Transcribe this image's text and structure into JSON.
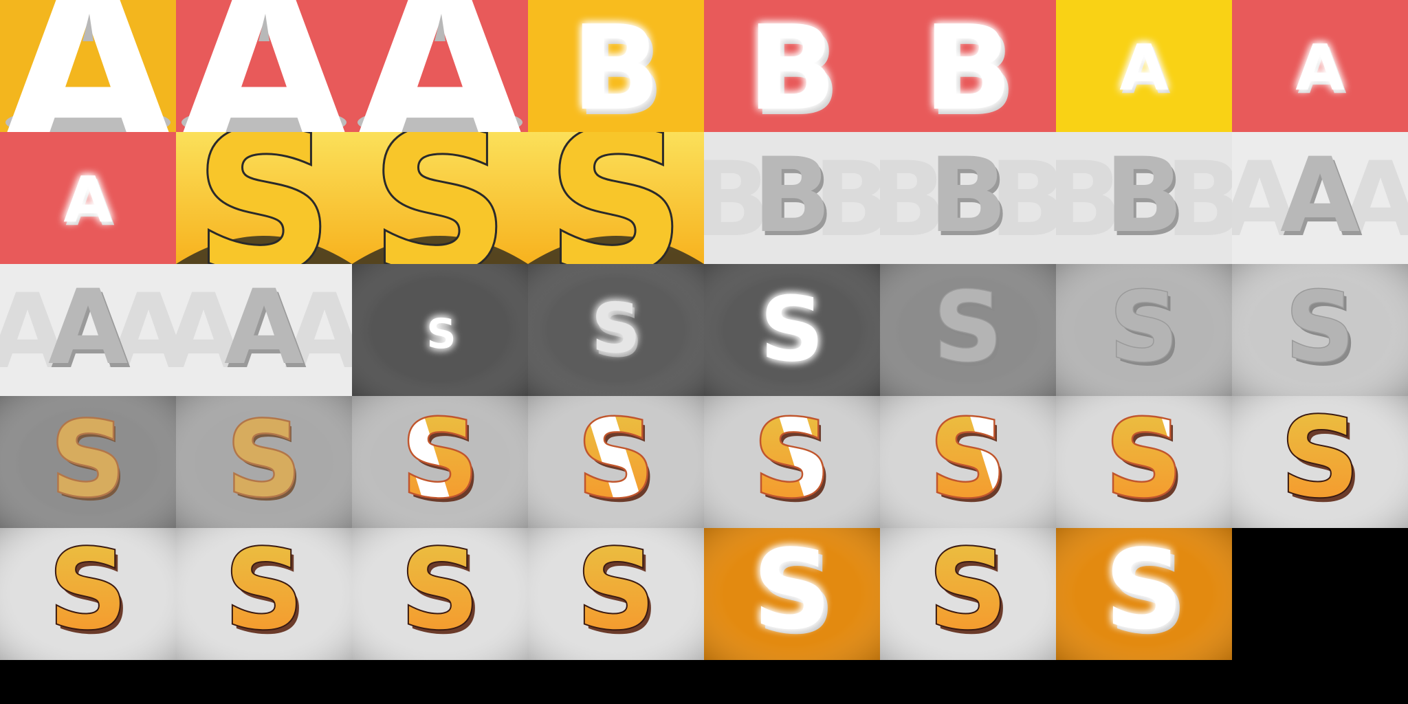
{
  "sheet": {
    "description_free": true,
    "palette": {
      "yellow_orange_bg": "#F8BC1E",
      "coral_bg": "#E85A5A",
      "gold_bg": "#F9D215",
      "s_gold_fill": "#F8C62A",
      "gray_dark_bg": "#555555",
      "gray_mid_bg": "#8C8C8C",
      "gray_light_bg": "#CFCFCF",
      "pale_bg": "#E9E9E9",
      "orange_bg": "#E38A10",
      "white": "#FFFFFF",
      "empty": "#000000"
    },
    "frames": [
      {
        "letter": "A",
        "style": "giant-white",
        "bg": "#F3B61E"
      },
      {
        "letter": "A",
        "style": "giant-white",
        "bg": "#E85A5A"
      },
      {
        "letter": "A",
        "style": "giant-white",
        "bg": "#E85A5A"
      },
      {
        "letter": "B",
        "style": "white-3d",
        "bg": "#F8BC1E"
      },
      {
        "letter": "B",
        "style": "white-3d",
        "bg": "#E85A5A"
      },
      {
        "letter": "B",
        "style": "white-3d",
        "bg": "#E85A5A"
      },
      {
        "letter": "A",
        "style": "white-small",
        "bg": "#F9D215"
      },
      {
        "letter": "A",
        "style": "white-small",
        "bg": "#E85A5A"
      },
      {
        "letter": "A",
        "style": "white-small",
        "bg": "#E85A5A"
      },
      {
        "letter": "S",
        "style": "giant-gold",
        "bg": "#F9D84A"
      },
      {
        "letter": "S",
        "style": "giant-gold",
        "bg": "#F9D84A"
      },
      {
        "letter": "S",
        "style": "giant-gold",
        "bg": "#F9D84A"
      },
      {
        "letter": "B",
        "style": "gray-echo",
        "bg": "#E6E6E6"
      },
      {
        "letter": "B",
        "style": "gray-echo",
        "bg": "#E6E6E6"
      },
      {
        "letter": "B",
        "style": "gray-echo",
        "bg": "#E6E6E6"
      },
      {
        "letter": "A",
        "style": "gray-echo",
        "bg": "#ECECEC"
      },
      {
        "letter": "A",
        "style": "gray-echo",
        "bg": "#ECECEC"
      },
      {
        "letter": "A",
        "style": "gray-echo",
        "bg": "#ECECEC"
      },
      {
        "letter": "S",
        "style": "glow-small",
        "bg": "#555555"
      },
      {
        "letter": "S",
        "style": "glow-medium",
        "bg": "#5C5C5C"
      },
      {
        "letter": "S",
        "style": "glow-large",
        "bg": "#5A5A5A"
      },
      {
        "letter": "S",
        "style": "gray-fade",
        "bg": "#8C8C8C"
      },
      {
        "letter": "S",
        "style": "gray-fade",
        "bg": "#B5B5B5"
      },
      {
        "letter": "S",
        "style": "gray-fade",
        "bg": "#C9C9C9"
      },
      {
        "letter": "S",
        "style": "orange-muted",
        "bg": "#8E8E8E"
      },
      {
        "letter": "S",
        "style": "orange-muted",
        "bg": "#A9A9A9"
      },
      {
        "letter": "S",
        "style": "orange-shine-1",
        "bg": "#BDBDBD"
      },
      {
        "letter": "S",
        "style": "orange-shine-2",
        "bg": "#CACACA"
      },
      {
        "letter": "S",
        "style": "orange-shine-3",
        "bg": "#D0D0D0"
      },
      {
        "letter": "S",
        "style": "orange-shine-4",
        "bg": "#D6D6D6"
      },
      {
        "letter": "S",
        "style": "orange-shine-5",
        "bg": "#DADADA"
      },
      {
        "letter": "S",
        "style": "orange",
        "bg": "#DDDDDD"
      },
      {
        "letter": "S",
        "style": "orange",
        "bg": "#E0E0E0"
      },
      {
        "letter": "S",
        "style": "orange",
        "bg": "#E0E0E0"
      },
      {
        "letter": "S",
        "style": "orange",
        "bg": "#E0E0E0"
      },
      {
        "letter": "S",
        "style": "orange",
        "bg": "#E0E0E0"
      },
      {
        "letter": "S",
        "style": "white-on-orange",
        "bg": "#E38A10"
      },
      {
        "letter": "S",
        "style": "orange",
        "bg": "#E0E0E0"
      },
      {
        "letter": "S",
        "style": "white-on-orange",
        "bg": "#E38A10"
      }
    ]
  }
}
